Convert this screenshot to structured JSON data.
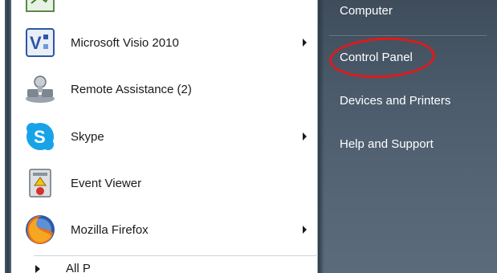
{
  "programs": [
    {
      "label": "",
      "icon": "spreadsheet-icon",
      "has_submenu": false
    },
    {
      "label": "Microsoft Visio 2010",
      "icon": "visio-icon",
      "has_submenu": true
    },
    {
      "label": "Remote Assistance (2)",
      "icon": "remote-assistance-icon",
      "has_submenu": false
    },
    {
      "label": "Skype",
      "icon": "skype-icon",
      "has_submenu": true
    },
    {
      "label": "Event Viewer",
      "icon": "event-viewer-icon",
      "has_submenu": false
    },
    {
      "label": "Mozilla Firefox",
      "icon": "firefox-icon",
      "has_submenu": true
    }
  ],
  "all_programs": {
    "label": "All P"
  },
  "places": [
    {
      "label": "Computer"
    },
    {
      "label": "Control Panel",
      "highlighted": true
    },
    {
      "label": "Devices and Printers"
    },
    {
      "label": "Help and Support"
    }
  ],
  "colors": {
    "highlight_ring": "#e01a1a",
    "places_background": "#4b5b6b",
    "places_text": "#ffffff",
    "program_text": "#1a1a1a"
  }
}
